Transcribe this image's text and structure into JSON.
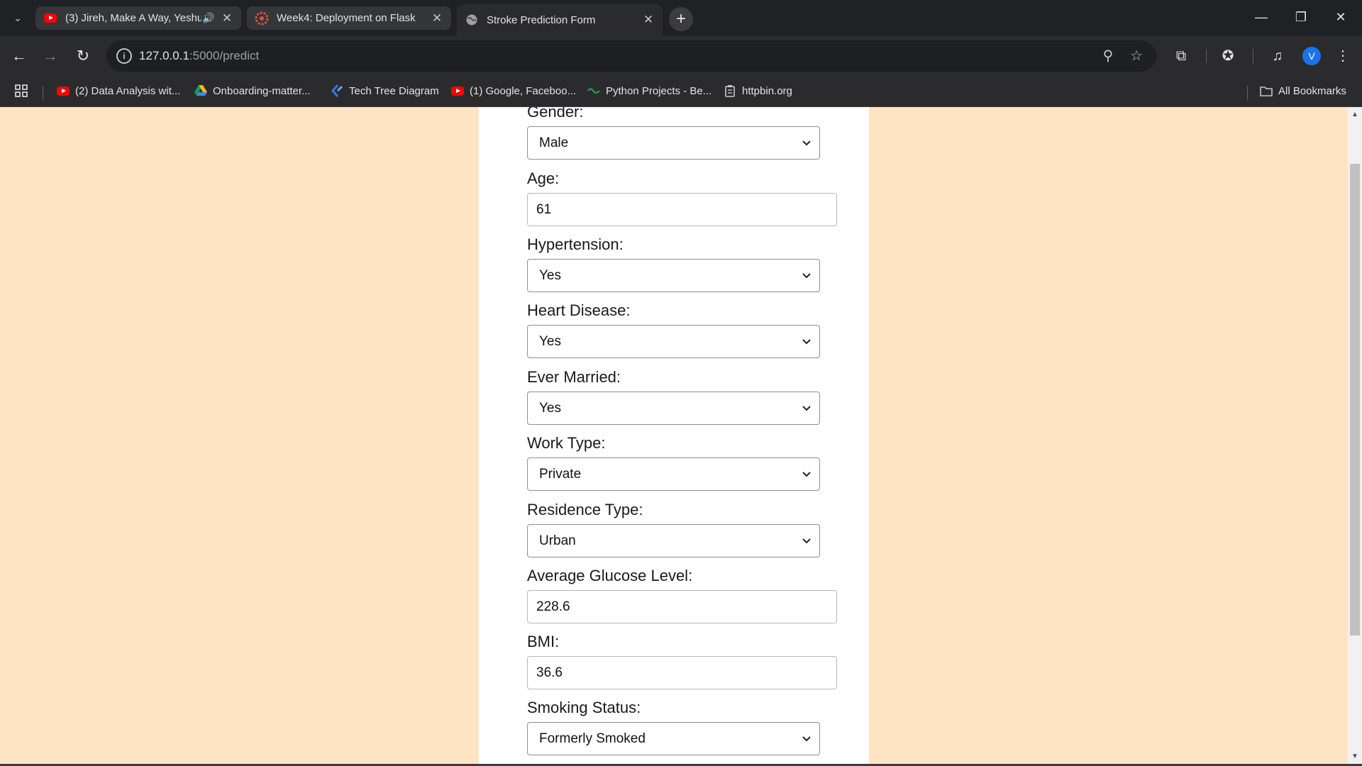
{
  "browser": {
    "tabs": [
      {
        "title": "(3) Jireh, Make A Way, Yeshua",
        "favicon": "youtube-icon",
        "audio": true
      },
      {
        "title": "Week4: Deployment on Flask",
        "favicon": "flask-course-icon"
      },
      {
        "title": "Stroke Prediction Form",
        "favicon": "globe-icon",
        "active": true
      }
    ],
    "url_host": "127.0.0.1",
    "url_path": ":5000/predict",
    "avatar_letter": "V",
    "bookmarks": [
      {
        "label": "(2) Data Analysis wit...",
        "icon": "youtube-icon"
      },
      {
        "label": "Onboarding-matter...",
        "icon": "google-drive-icon"
      },
      {
        "label": "Tech Tree Diagram",
        "icon": "tech-tree-icon"
      },
      {
        "label": "(1) Google, Faceboo...",
        "icon": "youtube-icon"
      },
      {
        "label": "Python Projects - Be...",
        "icon": "python-projects-icon"
      },
      {
        "label": "httpbin.org",
        "icon": "httpbin-icon"
      }
    ],
    "all_bookmarks_label": "All Bookmarks"
  },
  "form": {
    "gender": {
      "label": "Gender:",
      "value": "Male"
    },
    "age": {
      "label": "Age:",
      "value": "61"
    },
    "hypertension": {
      "label": "Hypertension:",
      "value": "Yes"
    },
    "heart_disease": {
      "label": "Heart Disease:",
      "value": "Yes"
    },
    "ever_married": {
      "label": "Ever Married:",
      "value": "Yes"
    },
    "work_type": {
      "label": "Work Type:",
      "value": "Private"
    },
    "residence_type": {
      "label": "Residence Type:",
      "value": "Urban"
    },
    "avg_glucose": {
      "label": "Average Glucose Level:",
      "value": "228.6"
    },
    "bmi": {
      "label": "BMI:",
      "value": "36.6"
    },
    "smoking_status": {
      "label": "Smoking Status:",
      "value": "Formerly Smoked"
    }
  },
  "colors": {
    "page_background": "#ffe4c4",
    "card_background": "#ffffff",
    "browser_frame": "#202124"
  }
}
